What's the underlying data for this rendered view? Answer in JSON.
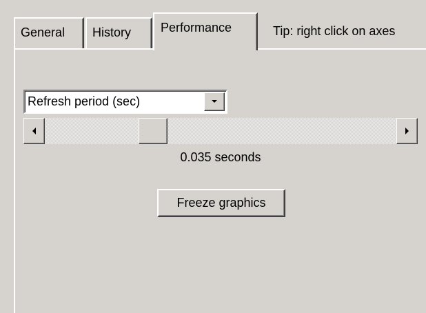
{
  "tabs": [
    {
      "label": "General",
      "active": false
    },
    {
      "label": "History",
      "active": false
    },
    {
      "label": "Performance",
      "active": true
    }
  ],
  "tip": "Tip: right click on axes",
  "refresh": {
    "selected": "Refresh period (sec)",
    "slider_fraction": 0.29,
    "value_text": "0.035 seconds"
  },
  "freeze_button_label": "Freeze graphics",
  "colors": {
    "background": "#d6d3ce",
    "highlight": "#ffffff",
    "shadow": "#848284",
    "dark_shadow": "#424142"
  },
  "icons": {
    "dropdown": "chevron-down-icon",
    "scroll_left": "arrow-left-icon",
    "scroll_right": "arrow-right-icon"
  }
}
